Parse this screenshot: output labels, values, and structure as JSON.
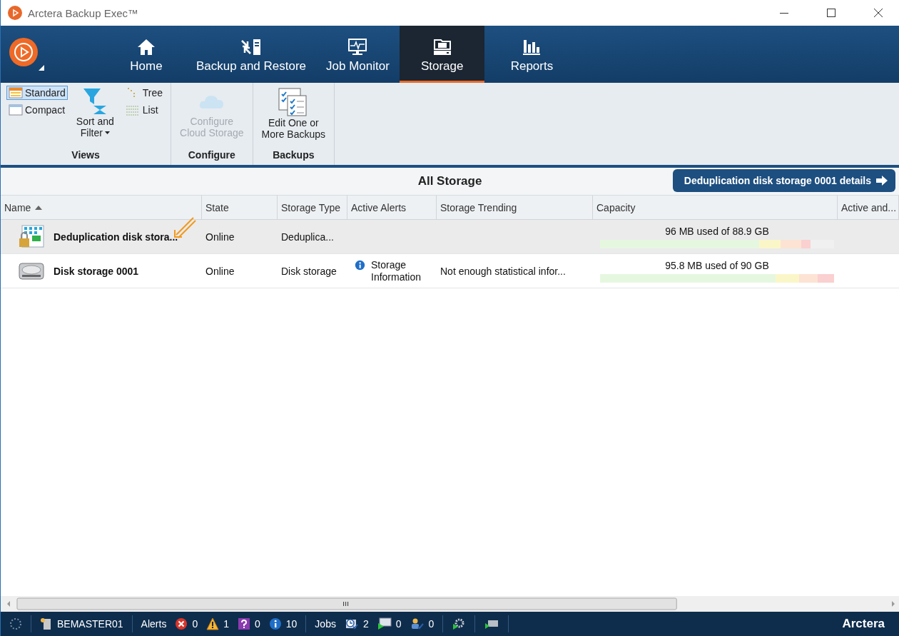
{
  "window": {
    "title": "Arctera Backup Exec™"
  },
  "nav": {
    "tabs": [
      {
        "label": "Home",
        "kind": "home",
        "selected": false
      },
      {
        "label": "Backup and Restore",
        "kind": "backup",
        "selected": false
      },
      {
        "label": "Job Monitor",
        "kind": "monitor",
        "selected": false
      },
      {
        "label": "Storage",
        "kind": "storage",
        "selected": true
      },
      {
        "label": "Reports",
        "kind": "reports",
        "selected": false
      }
    ]
  },
  "ribbon": {
    "views": {
      "label": "Views",
      "modes": [
        {
          "label": "Standard",
          "selected": true
        },
        {
          "label": "Compact",
          "selected": false
        }
      ],
      "sort_filter": {
        "lines": [
          "Sort and",
          "Filter"
        ]
      },
      "layouts": [
        {
          "label": "Tree"
        },
        {
          "label": "List"
        }
      ]
    },
    "configure": {
      "label": "Configure",
      "lines": [
        "Configure",
        "Cloud Storage"
      ],
      "disabled": true
    },
    "backups": {
      "label": "Backups",
      "lines": [
        "Edit One or",
        "More Backups"
      ],
      "disabled": false
    }
  },
  "content": {
    "title": "All Storage",
    "details_button": "Deduplication disk storage 0001 details"
  },
  "table": {
    "columns": [
      {
        "label": "Name",
        "sorted": true
      },
      {
        "label": "State"
      },
      {
        "label": "Storage Type"
      },
      {
        "label": "Active Alerts"
      },
      {
        "label": "Storage Trending"
      },
      {
        "label": "Capacity"
      },
      {
        "label": "Active and..."
      }
    ],
    "rows": [
      {
        "kind": "dedup",
        "selected": true,
        "name": "Deduplication disk stora...",
        "state": "Online",
        "storage_type": "Deduplica...",
        "capacity": "96 MB used of 88.9 GB"
      },
      {
        "kind": "disk",
        "selected": false,
        "name": "Disk storage 0001",
        "state": "Online",
        "storage_type": "Disk storage",
        "alert": "Storage Information",
        "trending": "Not enough statistical infor...",
        "capacity": "95.8 MB used of 90 GB"
      }
    ]
  },
  "status_bar": {
    "server": "BEMASTER01",
    "alerts_label": "Alerts",
    "alerts": [
      {
        "kind": "error",
        "count": "0"
      },
      {
        "kind": "warning",
        "count": "1"
      },
      {
        "kind": "question",
        "count": "0"
      },
      {
        "kind": "info",
        "count": "10"
      }
    ],
    "jobs_label": "Jobs",
    "jobs": [
      {
        "kind": "active",
        "count": "2"
      },
      {
        "kind": "scheduled",
        "count": "0"
      },
      {
        "kind": "attention",
        "count": "0"
      }
    ],
    "brand": "Arctera"
  }
}
